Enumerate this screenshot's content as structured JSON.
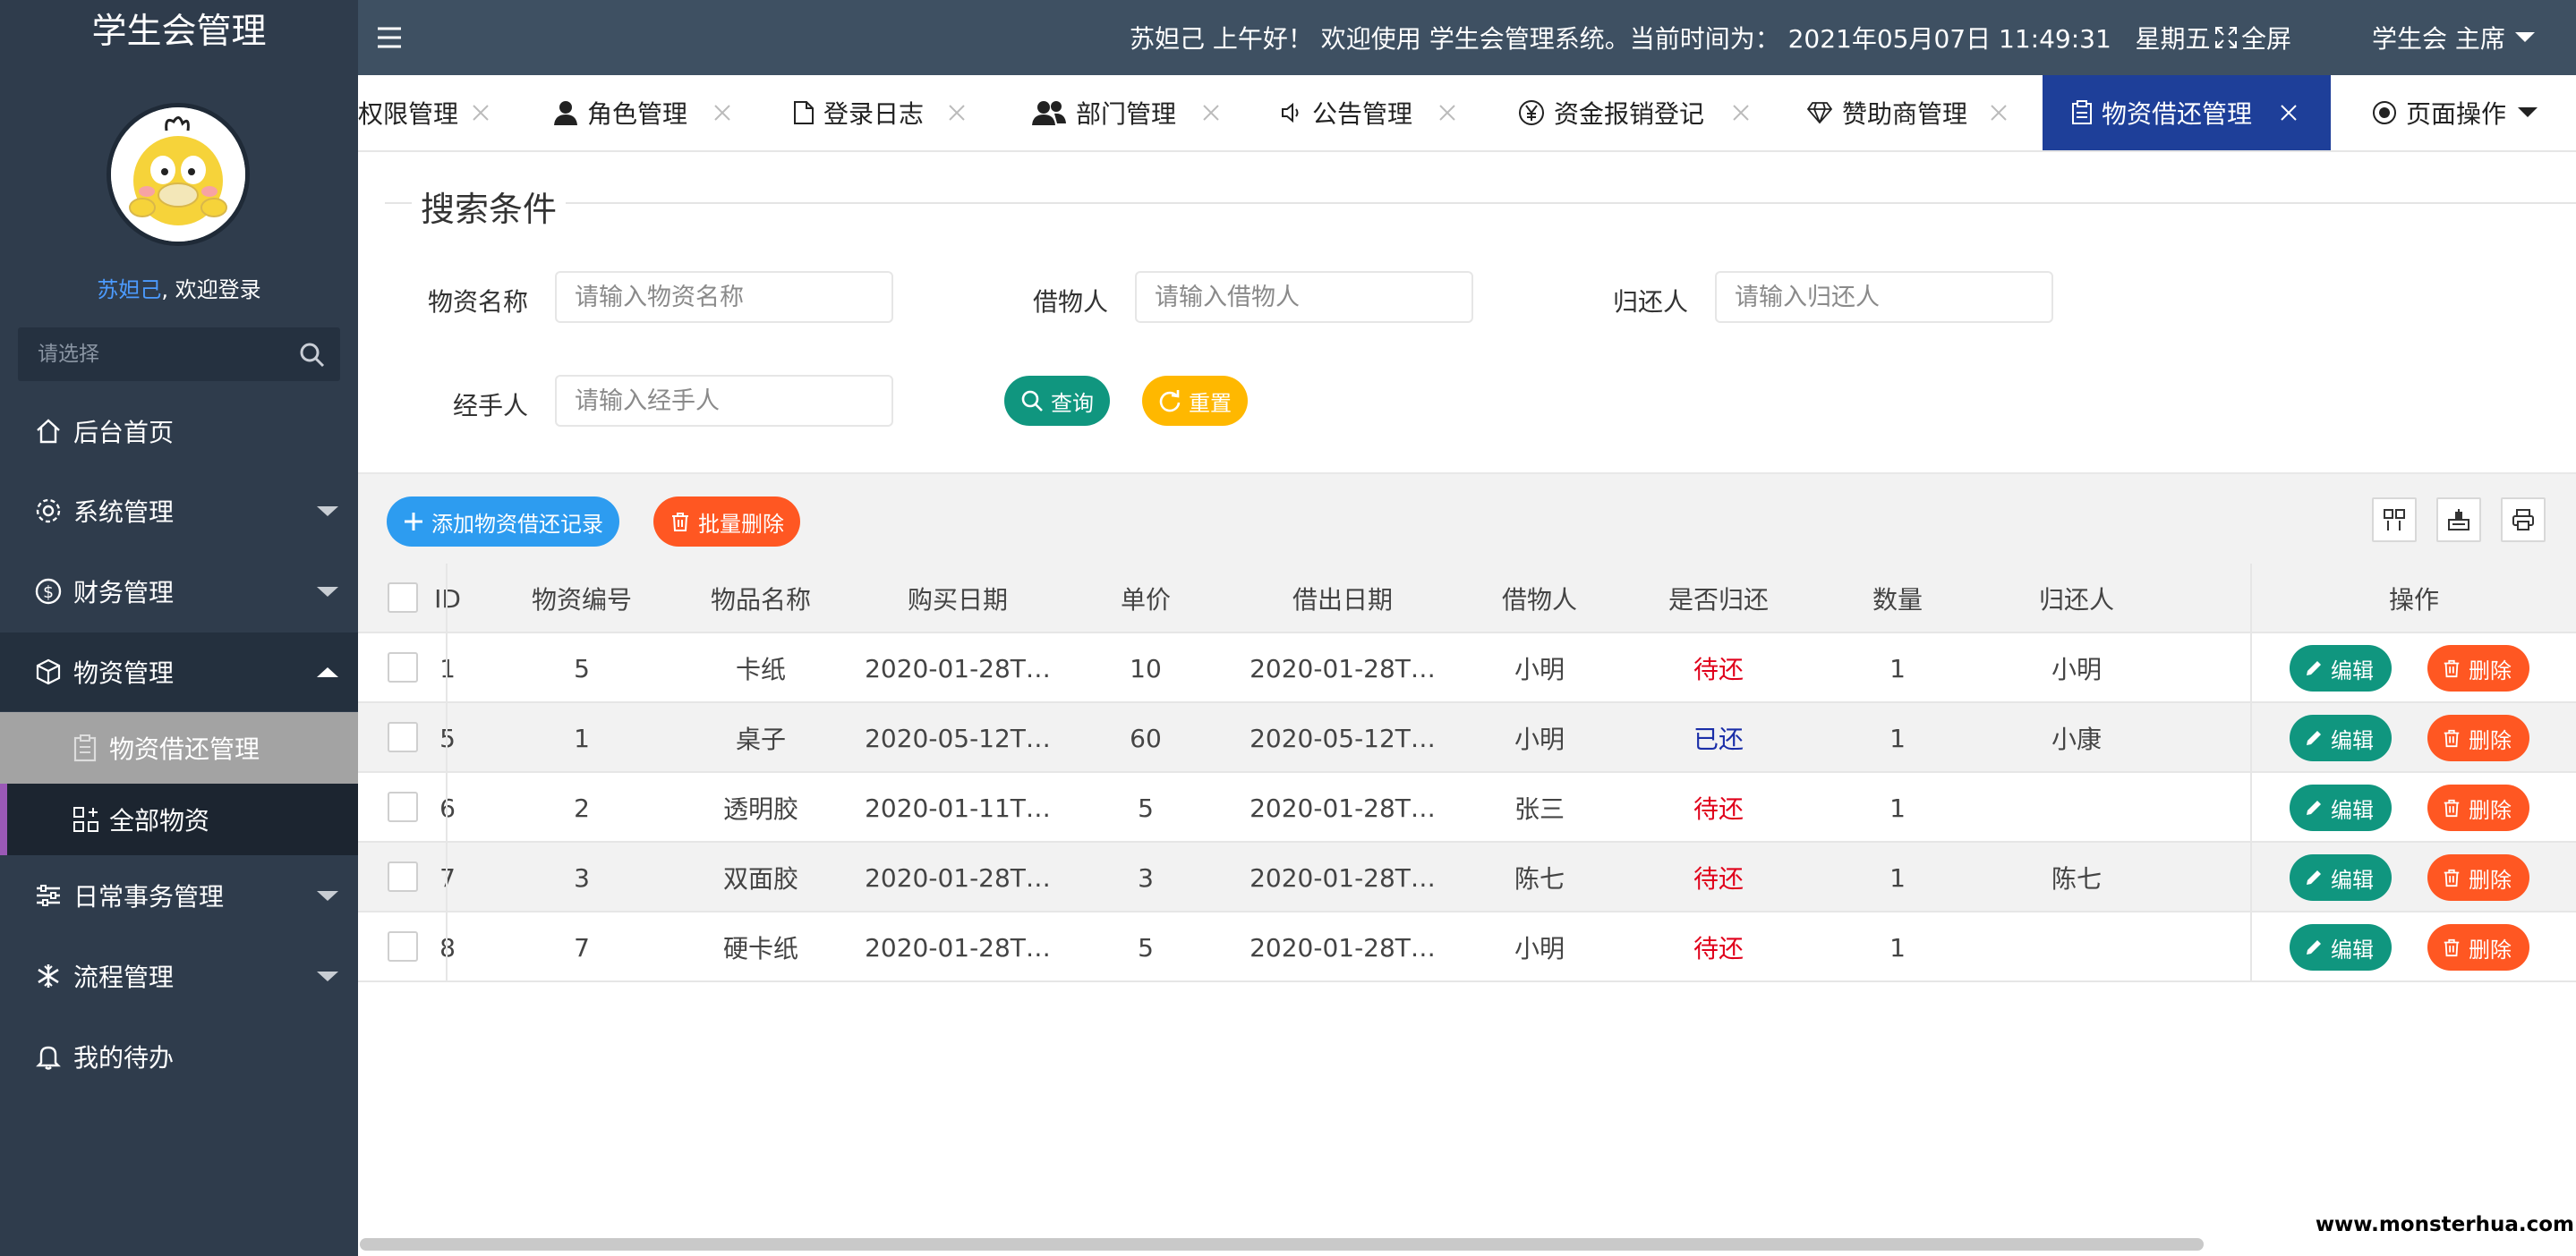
{
  "sidebar": {
    "title": "学生会管理",
    "user_name": "苏妲己",
    "welcome_suffix": ", 欢迎登录",
    "search_placeholder": "请选择",
    "menu": {
      "home": "后台首页",
      "system": "系统管理",
      "finance": "财务管理",
      "materials": "物资管理",
      "materials_loan": "物资借还管理",
      "materials_all": "全部物资",
      "daily": "日常事务管理",
      "process": "流程管理",
      "todo": "我的待办"
    }
  },
  "topbar": {
    "greeting": "苏妲己 上午好！ 欢迎使用 学生会管理系统。当前时间为： 2021年05月07日 11:49:31   星期五",
    "fullscreen": "全屏",
    "role": "学生会 主席"
  },
  "tabs": {
    "items": [
      "权限管理",
      "角色管理",
      "登录日志",
      "部门管理",
      "公告管理",
      "资金报销登记",
      "赞助商管理",
      "物资借还管理"
    ],
    "page_ops": "页面操作"
  },
  "search": {
    "legend": "搜索条件",
    "fields": [
      {
        "label": "物资名称",
        "placeholder": "请输入物资名称"
      },
      {
        "label": "借物人",
        "placeholder": "请输入借物人"
      },
      {
        "label": "归还人",
        "placeholder": "请输入归还人"
      },
      {
        "label": "经手人",
        "placeholder": "请输入经手人"
      }
    ],
    "query": "查询",
    "reset": "重置"
  },
  "toolbar": {
    "add": "添加物资借还记录",
    "batch_delete": "批量删除"
  },
  "table": {
    "headers": [
      "ID",
      "物资编号",
      "物品名称",
      "购买日期",
      "单价",
      "借出日期",
      "借物人",
      "是否归还",
      "数量",
      "归还人",
      "操作"
    ],
    "edit": "编辑",
    "delete": "删除",
    "rows": [
      {
        "id": "1",
        "code": "5",
        "name": "卡纸",
        "buy": "2020-01-28T…",
        "price": "10",
        "lend": "2020-01-28T…",
        "borrower": "小明",
        "status": "待还",
        "returned": false,
        "qty": "1",
        "returner": "小明"
      },
      {
        "id": "5",
        "code": "1",
        "name": "桌子",
        "buy": "2020-05-12T…",
        "price": "60",
        "lend": "2020-05-12T…",
        "borrower": "小明",
        "status": "已还",
        "returned": true,
        "qty": "1",
        "returner": "小康"
      },
      {
        "id": "6",
        "code": "2",
        "name": "透明胶",
        "buy": "2020-01-11T…",
        "price": "5",
        "lend": "2020-01-28T…",
        "borrower": "张三",
        "status": "待还",
        "returned": false,
        "qty": "1",
        "returner": ""
      },
      {
        "id": "7",
        "code": "3",
        "name": "双面胶",
        "buy": "2020-01-28T…",
        "price": "3",
        "lend": "2020-01-28T…",
        "borrower": "陈七",
        "status": "待还",
        "returned": false,
        "qty": "1",
        "returner": "陈七"
      },
      {
        "id": "8",
        "code": "7",
        "name": "硬卡纸",
        "buy": "2020-01-28T…",
        "price": "5",
        "lend": "2020-01-28T…",
        "borrower": "小明",
        "status": "待还",
        "returned": false,
        "qty": "1",
        "returner": ""
      }
    ]
  },
  "watermark": "www.monsterhua.com",
  "colors": {
    "sidebar": "#2f3c4c",
    "topbar": "#3e5062",
    "active_tab": "#1e3f99",
    "teal": "#10967f",
    "orange": "#ff5722",
    "yellow": "#ffb800",
    "blue": "#2d9cf0",
    "pending": "#e0001b",
    "returned": "#1a2ea8"
  }
}
